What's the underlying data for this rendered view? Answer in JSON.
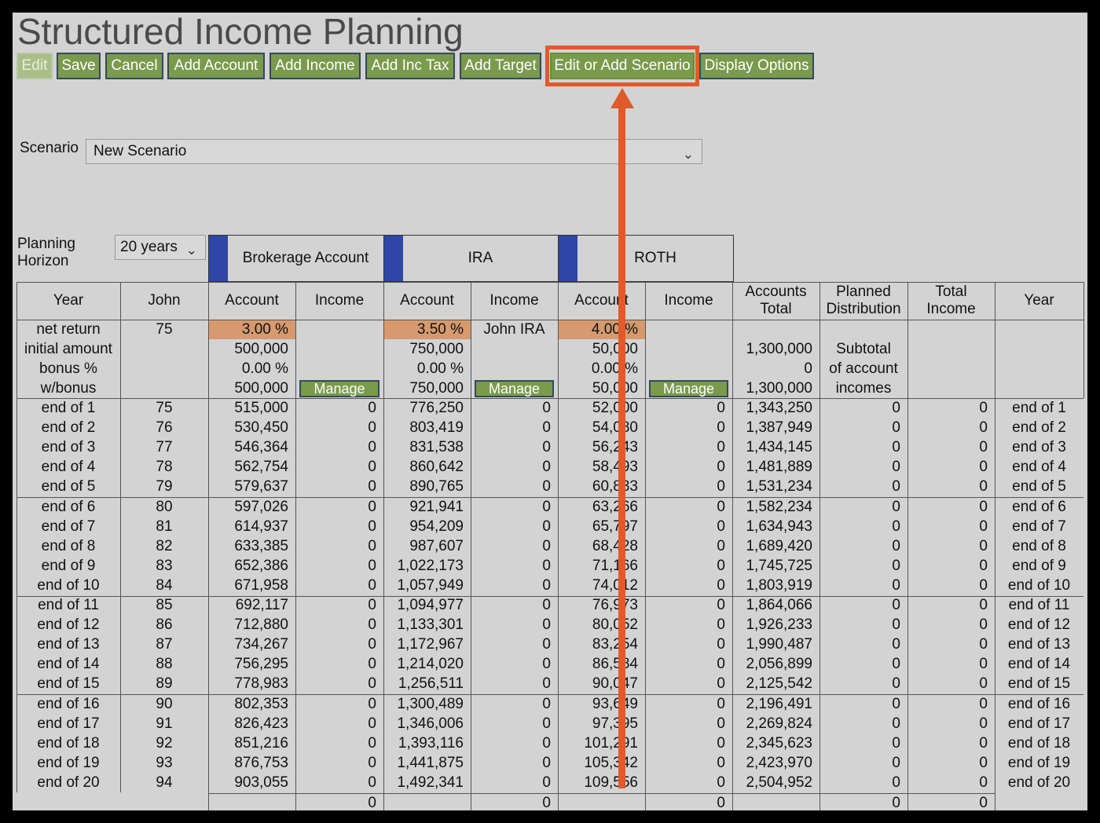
{
  "app": {
    "title": "Structured Income Planning"
  },
  "toolbar": {
    "edit": "Edit",
    "save": "Save",
    "cancel": "Cancel",
    "add_account": "Add Account",
    "add_income": "Add Income",
    "add_inc_tax": "Add Inc Tax",
    "add_target": "Add Target",
    "edit_scenario": "Edit or Add Scenario",
    "display_options": "Display Options"
  },
  "annotation": {
    "highlight_color": "#e05a2b",
    "target": "Edit or Add Scenario"
  },
  "scenario": {
    "label": "Scenario",
    "value": "New Scenario"
  },
  "planning": {
    "label_line1": "Planning",
    "label_line2": "Horizon",
    "value": "20 years"
  },
  "accounts": [
    "Brokerage Account",
    "IRA",
    "ROTH"
  ],
  "columns": {
    "year": "Year",
    "person": "John",
    "account": "Account",
    "income": "Income",
    "accounts_total_1": "Accounts",
    "accounts_total_2": "Total",
    "planned_1": "Planned",
    "planned_2": "Distribution",
    "total_income_1": "Total",
    "total_income_2": "Income",
    "year_right": "Year"
  },
  "params": {
    "labels": [
      "net return",
      "initial amount",
      "bonus %",
      "w/bonus"
    ],
    "age": "75",
    "brokerage": {
      "net_return": "3.00  %",
      "initial": "500,000",
      "bonus": "0.00  %",
      "with_bonus": "500,000"
    },
    "ira": {
      "net_return": "3.50  %",
      "initial": "750,000",
      "bonus": "0.00  %",
      "with_bonus": "750,000",
      "income_label": "John IRA"
    },
    "roth": {
      "net_return": "4.00  %",
      "initial": "50,000",
      "bonus": "0.00  %",
      "with_bonus": "50,000"
    },
    "accounts_total": {
      "initial": "1,300,000",
      "bonus": "0",
      "with_bonus": "1,300,000"
    },
    "planned": {
      "line1": "Subtotal",
      "line2": "of account",
      "line3": "incomes"
    },
    "manage_label": "Manage"
  },
  "rows": [
    [
      "end of 1",
      "75",
      "515,000",
      "0",
      "776,250",
      "0",
      "52,000",
      "0",
      "1,343,250",
      "0",
      "0",
      "end of 1"
    ],
    [
      "end of 2",
      "76",
      "530,450",
      "0",
      "803,419",
      "0",
      "54,080",
      "0",
      "1,387,949",
      "0",
      "0",
      "end of 2"
    ],
    [
      "end of 3",
      "77",
      "546,364",
      "0",
      "831,538",
      "0",
      "56,243",
      "0",
      "1,434,145",
      "0",
      "0",
      "end of 3"
    ],
    [
      "end of 4",
      "78",
      "562,754",
      "0",
      "860,642",
      "0",
      "58,493",
      "0",
      "1,481,889",
      "0",
      "0",
      "end of 4"
    ],
    [
      "end of 5",
      "79",
      "579,637",
      "0",
      "890,765",
      "0",
      "60,833",
      "0",
      "1,531,234",
      "0",
      "0",
      "end of 5"
    ],
    [
      "end of 6",
      "80",
      "597,026",
      "0",
      "921,941",
      "0",
      "63,266",
      "0",
      "1,582,234",
      "0",
      "0",
      "end of 6"
    ],
    [
      "end of 7",
      "81",
      "614,937",
      "0",
      "954,209",
      "0",
      "65,797",
      "0",
      "1,634,943",
      "0",
      "0",
      "end of 7"
    ],
    [
      "end of 8",
      "82",
      "633,385",
      "0",
      "987,607",
      "0",
      "68,428",
      "0",
      "1,689,420",
      "0",
      "0",
      "end of 8"
    ],
    [
      "end of 9",
      "83",
      "652,386",
      "0",
      "1,022,173",
      "0",
      "71,166",
      "0",
      "1,745,725",
      "0",
      "0",
      "end of 9"
    ],
    [
      "end of 10",
      "84",
      "671,958",
      "0",
      "1,057,949",
      "0",
      "74,012",
      "0",
      "1,803,919",
      "0",
      "0",
      "end of 10"
    ],
    [
      "end of 11",
      "85",
      "692,117",
      "0",
      "1,094,977",
      "0",
      "76,973",
      "0",
      "1,864,066",
      "0",
      "0",
      "end of 11"
    ],
    [
      "end of 12",
      "86",
      "712,880",
      "0",
      "1,133,301",
      "0",
      "80,052",
      "0",
      "1,926,233",
      "0",
      "0",
      "end of 12"
    ],
    [
      "end of 13",
      "87",
      "734,267",
      "0",
      "1,172,967",
      "0",
      "83,254",
      "0",
      "1,990,487",
      "0",
      "0",
      "end of 13"
    ],
    [
      "end of 14",
      "88",
      "756,295",
      "0",
      "1,214,020",
      "0",
      "86,584",
      "0",
      "2,056,899",
      "0",
      "0",
      "end of 14"
    ],
    [
      "end of 15",
      "89",
      "778,983",
      "0",
      "1,256,511",
      "0",
      "90,047",
      "0",
      "2,125,542",
      "0",
      "0",
      "end of 15"
    ],
    [
      "end of 16",
      "90",
      "802,353",
      "0",
      "1,300,489",
      "0",
      "93,649",
      "0",
      "2,196,491",
      "0",
      "0",
      "end of 16"
    ],
    [
      "end of 17",
      "91",
      "826,423",
      "0",
      "1,346,006",
      "0",
      "97,395",
      "0",
      "2,269,824",
      "0",
      "0",
      "end of 17"
    ],
    [
      "end of 18",
      "92",
      "851,216",
      "0",
      "1,393,116",
      "0",
      "101,291",
      "0",
      "2,345,623",
      "0",
      "0",
      "end of 18"
    ],
    [
      "end of 19",
      "93",
      "876,753",
      "0",
      "1,441,875",
      "0",
      "105,342",
      "0",
      "2,423,970",
      "0",
      "0",
      "end of 19"
    ],
    [
      "end of 20",
      "94",
      "903,055",
      "0",
      "1,492,341",
      "0",
      "109,556",
      "0",
      "2,504,952",
      "0",
      "0",
      "end of 20"
    ]
  ],
  "totals": [
    "0",
    "0",
    "0",
    "0",
    "0"
  ]
}
